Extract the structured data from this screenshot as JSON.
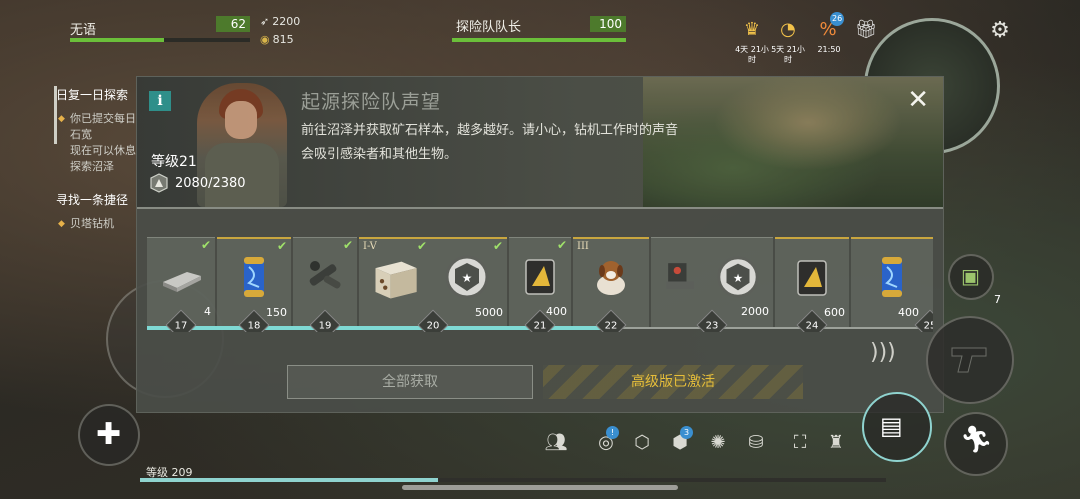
{
  "hud": {
    "player_name": "无语",
    "player_value": "62",
    "resource1": "2200",
    "resource2": "815",
    "leader_name": "探险队队长",
    "leader_value": "100",
    "timer1": "4天 21小时",
    "timer2": "5天 21小时",
    "timer3": "21:50",
    "badge_count": "26",
    "bag_count": "7",
    "chat_badge": "3"
  },
  "quest": {
    "title": "日复一日探索",
    "line1": "你已提交每日的矿石宽",
    "line2": "现在可以休息一下",
    "line3": "探索沼泽",
    "title2": "寻找一条捷径",
    "line4": "贝塔钻机"
  },
  "modal": {
    "title": "起源探险队声望",
    "description": "前往沼泽并获取矿石样本，越多越好。请小心，钻机工作时的声音会吸引感染者和其他生物。",
    "level": "等级21",
    "xp": "2080/2380",
    "info_icon": "i",
    "close_icon": "✕",
    "btn_collect_all": "全部获取",
    "btn_premium": "高级版已激活"
  },
  "rewards": [
    {
      "level": "17",
      "qty": "4",
      "item": "metal-ingot",
      "claimed": true,
      "premium": false
    },
    {
      "level": "18",
      "qty": "150",
      "item": "dna-capsule",
      "claimed": true,
      "premium": true
    },
    {
      "level": "19",
      "qty": "",
      "item": "pipe-parts",
      "claimed": true,
      "premium": false
    },
    {
      "level": "20",
      "qty": "5000",
      "item": "crate-and-medal",
      "claimed": true,
      "premium": true,
      "tier": "I-V"
    },
    {
      "level": "21",
      "qty": "400",
      "item": "gold-card",
      "claimed": true,
      "premium": false
    },
    {
      "level": "22",
      "qty": "",
      "item": "dog",
      "claimed": false,
      "premium": true,
      "tier": "III"
    },
    {
      "level": "23",
      "qty": "2000",
      "item": "machine-and-medal",
      "claimed": false,
      "premium": false
    },
    {
      "level": "24",
      "qty": "600",
      "item": "gold-card",
      "claimed": false,
      "premium": true
    },
    {
      "level": "25",
      "qty": "400",
      "item": "dna-capsule",
      "claimed": false,
      "premium": true
    }
  ],
  "footer": {
    "level_label": "等级 209"
  },
  "colors": {
    "accent_green": "#6bbf3a",
    "accent_teal": "#7fd9d4",
    "gold": "#d9b441",
    "modal_bg": "#4a4e48"
  }
}
